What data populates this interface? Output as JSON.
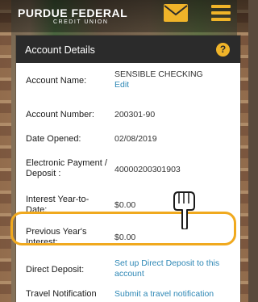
{
  "header": {
    "logo_line1": "PURDUE FEDERAL",
    "logo_line2": "CREDIT UNION",
    "mail_icon": "mail-icon",
    "menu_icon": "menu-icon"
  },
  "panel": {
    "title": "Account Details",
    "help_icon": "help-icon",
    "rows": [
      {
        "label": "Account Name:",
        "value": "SENSIBLE CHECKING",
        "link": "Edit"
      },
      {
        "label": "Account Number:",
        "value": "200301-90"
      },
      {
        "label": "Date Opened:",
        "value": "02/08/2019"
      },
      {
        "label": "Electronic Payment / Deposit :",
        "value": "40000200301903"
      },
      {
        "label": "Interest Year-to-Date:",
        "value": "$0.00"
      },
      {
        "label": "Previous Year's Interest:",
        "value": "$0.00"
      },
      {
        "label": "Direct Deposit:",
        "link": "Set up Direct Deposit to this account"
      },
      {
        "label": "Travel Notification",
        "link": "Submit a travel notification"
      }
    ]
  },
  "colors": {
    "accent": "#f0b429",
    "link": "#2d87b5",
    "header_dark": "#2b2b2b"
  }
}
